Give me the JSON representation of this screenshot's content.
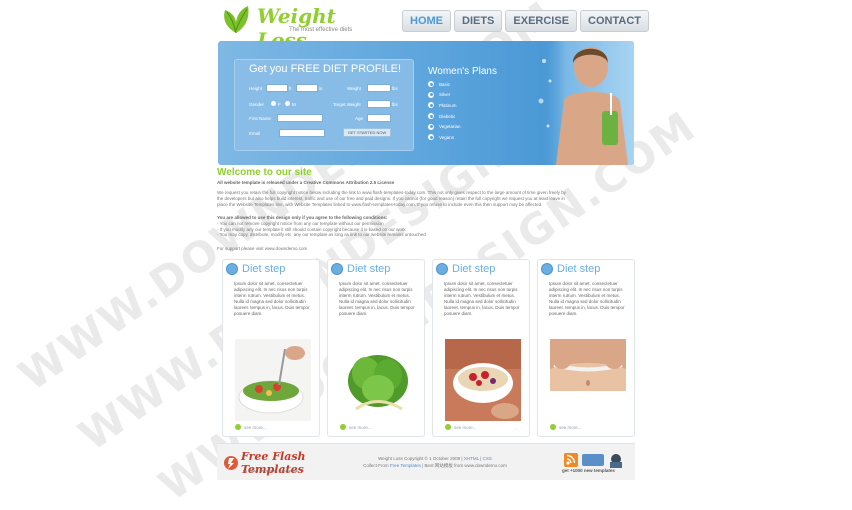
{
  "watermark": {
    "text": "WWW.DOWNDESIGN.COM"
  },
  "header": {
    "logo_title": "Weight Loss",
    "logo_tagline": "The most effective diets",
    "nav": [
      {
        "label": "HOME",
        "active": true
      },
      {
        "label": "DIETS",
        "active": false
      },
      {
        "label": "EXERCISE",
        "active": false
      },
      {
        "label": "CONTACT",
        "active": false
      }
    ]
  },
  "profile_form": {
    "title": "Get you FREE DIET PROFILE!",
    "height_label": "Height",
    "ft_label": "ft",
    "in_label": "in",
    "weight_label": "Weight",
    "lbs_label": "lbs",
    "gender_label": "Gender",
    "female_label": "F",
    "male_label": "M",
    "target_weight_label": "Target Weight",
    "lbs2_label": "lbs",
    "first_name_label": "First Name",
    "age_label": "Age",
    "email_label": "Email",
    "submit_label": "GET STARTED NOW"
  },
  "plans": {
    "title": "Women's Plans",
    "items": [
      "Basic",
      "Silver",
      "Platinum",
      "Diabetic",
      "Vegetarian",
      "Vegans"
    ]
  },
  "welcome": {
    "title": "Welcome to our site",
    "license": "All website template is released under a Creative Commons Attribution 2.5 License",
    "para1": [
      "We request you retain the full copyright notice below including the link to www.flash-templates-today.com. This not only gives respect to the large amount of time given freely by",
      "the developers but also helps build interest, traffic and use of our free and paid designs. If you cannot (for good reason) retain the full copyright we request you at least leave in",
      "place the Website Templates line, with Website Templates linked to www.flash-templates-today.com. If you refuse to include even this then support may be affected."
    ],
    "allowed_title": "You are allowed to use this design only if you agree to the following conditions:",
    "conditions": [
      "- You can not remove copyright notice from any our template without our permission",
      "- If you modify any our template it still should contain copyright because it is based on our work",
      "- You may copy, distribute, modify etc. any our template as long as link to our website remains untouched"
    ],
    "support": "For support please visit www.downdemo.com"
  },
  "steps": [
    {
      "title": "Diet step",
      "body": "Ipsum dolor sit amet, consectetuer adipiscing elit. In nec risus non turpis interm rutrum. Vestibulum et metus. Nulla id magna sed dolor sollicitudin laoreet. tempus in, lacus. Duis tempor posuere diam.",
      "more": "see more..."
    },
    {
      "title": "Diet step",
      "body": "Ipsum dolor sit amet, consectetuer adipiscing elit. In nec risus non turpis interm rutrum. Vestibulum et metus. Nulla id magna sed dolor sollicitudin laoreet. tempus in, lacus. Duis tempor posuere diam.",
      "more": "see more..."
    },
    {
      "title": "Diet step",
      "body": "Ipsum dolor sit amet, consectetuer adipiscing elit. In nec risus non turpis interm rutrum. Vestibulum et metus. Nulla id magna sed dolor sollicitudin laoreet. tempus in, lacus. Duis tempor posuere diam.",
      "more": "see more..."
    },
    {
      "title": "Diet step",
      "body": "Ipsum dolor sit amet, consectetuer adipiscing elit. In nec risus non turpis interm rutrum. Vestibulum et metus. Nulla id magna sed dolor sollicitudin laoreet. tempus in, lacus. Duis tempor posuere diam.",
      "more": "see more..."
    }
  ],
  "footer": {
    "logo_title": "Free Flash Templates",
    "logo_sub": "by Flash Templates Resources",
    "line1_pre": "Weight Loss Copyright © 1 October 2009 |",
    "line1_link1": "XHTML",
    "line1_sep": "|",
    "line1_link2": "CSS",
    "line2_pre": "Collect From",
    "line2_link": "Free Templates",
    "line2_post": "| Best 网站模板 from www.downdemo.com",
    "badge_text": "get +1000 new templates"
  },
  "colors": {
    "accent_green": "#8fcf2e",
    "accent_blue": "#6aaee2",
    "banner_blue": "#5aa3dc",
    "footer_red": "#c63a2a"
  }
}
